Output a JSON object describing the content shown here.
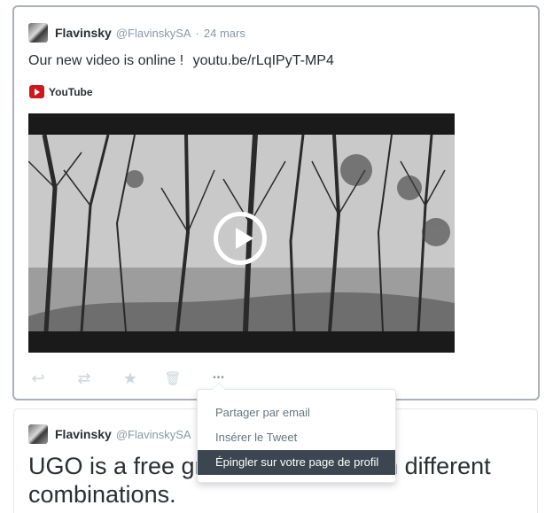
{
  "tweet1": {
    "name": "Flavinsky",
    "handle": "@FlavinskySA",
    "separator": "·",
    "date": "24 mars",
    "text": "Our new video is online !",
    "link": "youtu.be/rLqIPyT-MP4",
    "card_source": "YouTube",
    "actions": [
      {
        "name": "reply-icon",
        "glyph": "↩"
      },
      {
        "name": "retweet-icon",
        "glyph": "⇄"
      },
      {
        "name": "favorite-icon",
        "glyph": "★"
      },
      {
        "name": "delete-icon",
        "glyph": "🗑"
      },
      {
        "name": "more-icon",
        "glyph": "•••"
      }
    ]
  },
  "menu": {
    "items": [
      {
        "label": "Partager par email"
      },
      {
        "label": "Insérer le Tweet"
      },
      {
        "label": "Épingler sur votre page de profil"
      }
    ],
    "active_index": 2
  },
  "tweet2": {
    "name": "Flavinsky",
    "handle": "@FlavinskySA",
    "text": "UGO is a free gr                       with different combinations."
  },
  "colors": {
    "text": "#292f33",
    "muted": "#8899a6",
    "action": "#ccd6dd",
    "menu_active": "#3b4650",
    "youtube": "#cc181e"
  }
}
